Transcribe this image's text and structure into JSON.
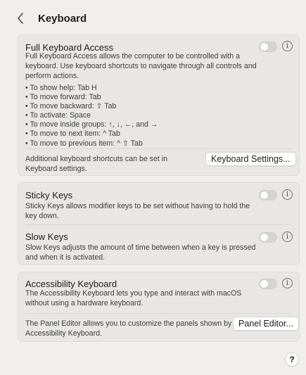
{
  "header": {
    "back_icon": "chevron-left-icon",
    "title": "Keyboard"
  },
  "full_keyboard_access": {
    "title": "Full Keyboard Access",
    "description": "Full Keyboard Access allows the computer to be controlled with a keyboard. Use keyboard shortcuts to navigate through all controls and perform actions.",
    "toggle_on": false,
    "shortcuts": [
      "• To show help: Tab H",
      "• To move forward: Tab",
      "• To move backward: ⇧ Tab",
      "• To activate: Space",
      "• To move inside groups: ↑, ↓, ←, and →",
      "• To move to next item: ^ Tab",
      "• To move to previous item: ^ ⇧ Tab"
    ],
    "footer_text": "Additional keyboard shortcuts can be set in Keyboard settings.",
    "button_label": "Keyboard Settings..."
  },
  "sticky_keys": {
    "title": "Sticky Keys",
    "description": "Sticky Keys allows modifier keys to be set without having to hold the key down.",
    "toggle_on": false
  },
  "slow_keys": {
    "title": "Slow Keys",
    "description": "Slow Keys adjusts the amount of time between when a key is pressed and when it is activated.",
    "toggle_on": false
  },
  "accessibility_keyboard": {
    "title": "Accessibility Keyboard",
    "description": "The Accessibility Keyboard lets you type and interact with macOS without using a hardware keyboard.",
    "toggle_on": false,
    "footer_text": "The Panel Editor allows you to customize the panels shown by Accessibility Keyboard.",
    "button_label": "Panel Editor..."
  },
  "info_glyph": "i",
  "help_label": "?",
  "colors": {
    "background": "#f0efee",
    "card": "#e8e7e6",
    "toggle_off": "#d5d4d3"
  }
}
